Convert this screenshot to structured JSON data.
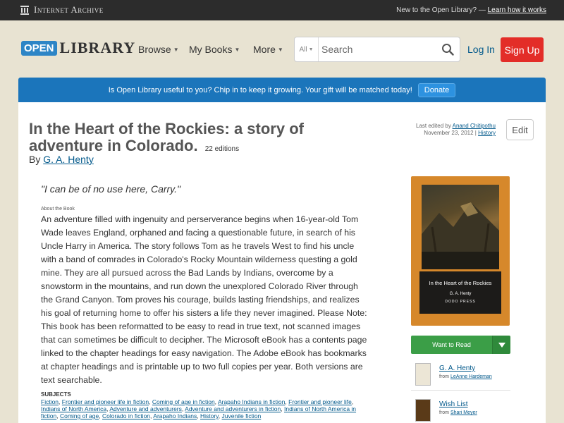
{
  "ia_bar": {
    "logo_text": "Internet Archive",
    "promo_text": "New to the Open Library? —",
    "promo_link": "Learn how it works"
  },
  "header": {
    "logo_open": "OPEN",
    "logo_library": "LIBRARY",
    "nav": [
      {
        "label": "Browse"
      },
      {
        "label": "My Books"
      },
      {
        "label": "More"
      }
    ],
    "search": {
      "scope": "All",
      "placeholder": "Search"
    },
    "login_label": "Log In",
    "signup_label": "Sign Up"
  },
  "banner": {
    "text": "Is Open Library useful to you? Chip in to keep it growing. Your gift will be matched today!",
    "donate_label": "Donate"
  },
  "book": {
    "title": "In the Heart of the Rockies: a story of adventure in Colorado.",
    "editions": "22 editions",
    "by_prefix": "By",
    "author": "G. A. Henty",
    "edited_prefix": "Last edited by",
    "edited_by": "Anand Chitipothu",
    "edited_date": "November 23, 2012 |",
    "history_label": "History",
    "edit_label": "Edit",
    "quote": "\"I can be of no use here, Carry.\"",
    "about_label": "About the Book",
    "description": "An adventure filled with ingenuity and perserverance begins when 16-year-old Tom Wade leaves England, orphaned and facing a questionable future, in search of his Uncle Harry in America. The story follows Tom as he travels West to find his uncle with a band of comrades in Colorado's Rocky Mountain wilderness questing a gold mine. They are all pursued across the Bad Lands by Indians, overcome by a snowstorm in the mountains, and run down the unexplored Colorado River through the Grand Canyon. Tom proves his courage, builds lasting friendships, and realizes his goal of returning home to offer his sisters a life they never imagined. Please Note: This book has been reformatted to be easy to read in true text, not scanned images that can sometimes be difficult to decipher. The Microsoft eBook has a contents page linked to the chapter headings for easy navigation. The Adobe eBook has bookmarks at chapter headings and is printable up to two full copies per year. Both versions are text searchable.",
    "subjects_heading": "SUBJECTS",
    "subjects": [
      "Fiction",
      "Frontier and pioneer life in fiction",
      "Coming of age in fiction",
      "Arapaho Indians in fiction",
      "Frontier and pioneer life",
      "Indians of North America",
      "Adventure and adventurers",
      "Adventure and adventurers in fiction",
      "Indians of North America in fiction",
      "Coming of age",
      "Colorado in fiction",
      "Arapaho Indians",
      "History",
      "Juvenile fiction"
    ]
  },
  "cover": {
    "title": "In the Heart of the Rockies",
    "author": "G. A. Henty",
    "publisher": "DODO PRESS"
  },
  "sidebar": {
    "want_label": "Want to Read",
    "lists": [
      {
        "name": "G. A. Henty",
        "from_prefix": "from",
        "from": "LeAnne Hardeman"
      },
      {
        "name": "Wish List",
        "from_prefix": "from",
        "from": "Shari Meyer"
      }
    ]
  },
  "colors": {
    "banner": "#1b75bb",
    "signup": "#e32d28",
    "want_to_read": "#3b9e47",
    "link": "#02598b"
  }
}
